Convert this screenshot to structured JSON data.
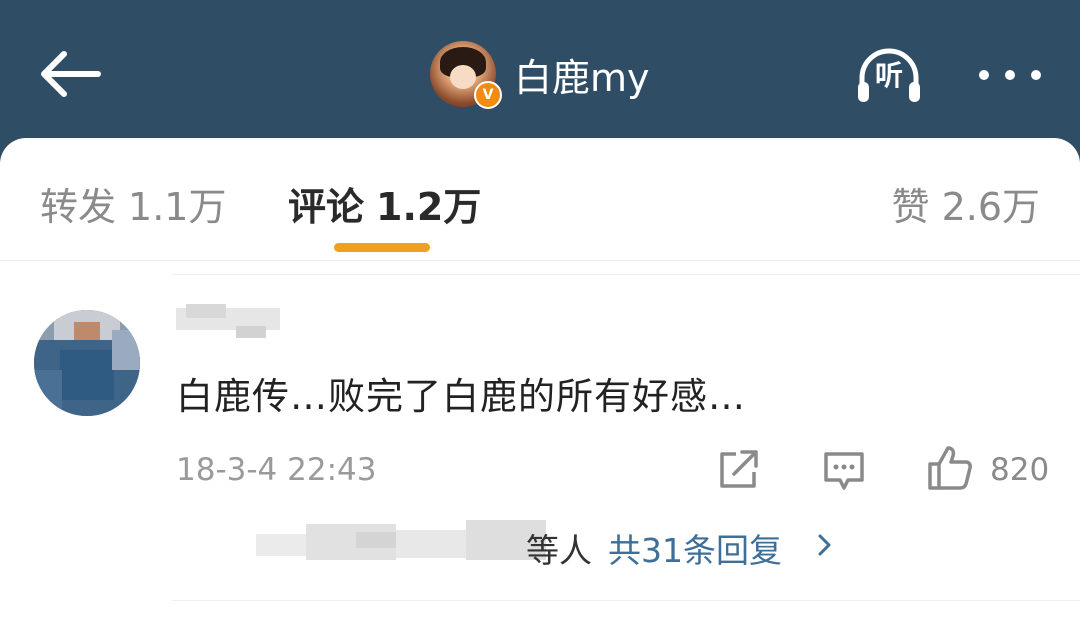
{
  "header": {
    "title": "白鹿my",
    "verified_badge": "V",
    "listen_label": "听",
    "icons": {
      "back": "back-arrow-icon",
      "listen": "headphones-icon",
      "more": "more-dots-icon"
    },
    "colors": {
      "background": "#2f4d64",
      "badge": "#f28c10"
    }
  },
  "tabs": [
    {
      "label": "转发",
      "count": "1.1万",
      "active": false
    },
    {
      "label": "评论",
      "count": "1.2万",
      "active": true
    },
    {
      "label": "赞",
      "count": "2.6万",
      "active": false
    }
  ],
  "accent_color": "#f0a020",
  "comment": {
    "text": "白鹿传…败完了白鹿的所有好感…",
    "timestamp": "18-3-4 22:43",
    "like_count": "820",
    "reply_partial": "等人",
    "reply_count_label": "共31条回复",
    "icons": {
      "share": "share-icon",
      "reply": "comment-icon",
      "like": "thumbs-up-icon",
      "chevron": "chevron-right-icon"
    },
    "link_color": "#3d6f99"
  }
}
